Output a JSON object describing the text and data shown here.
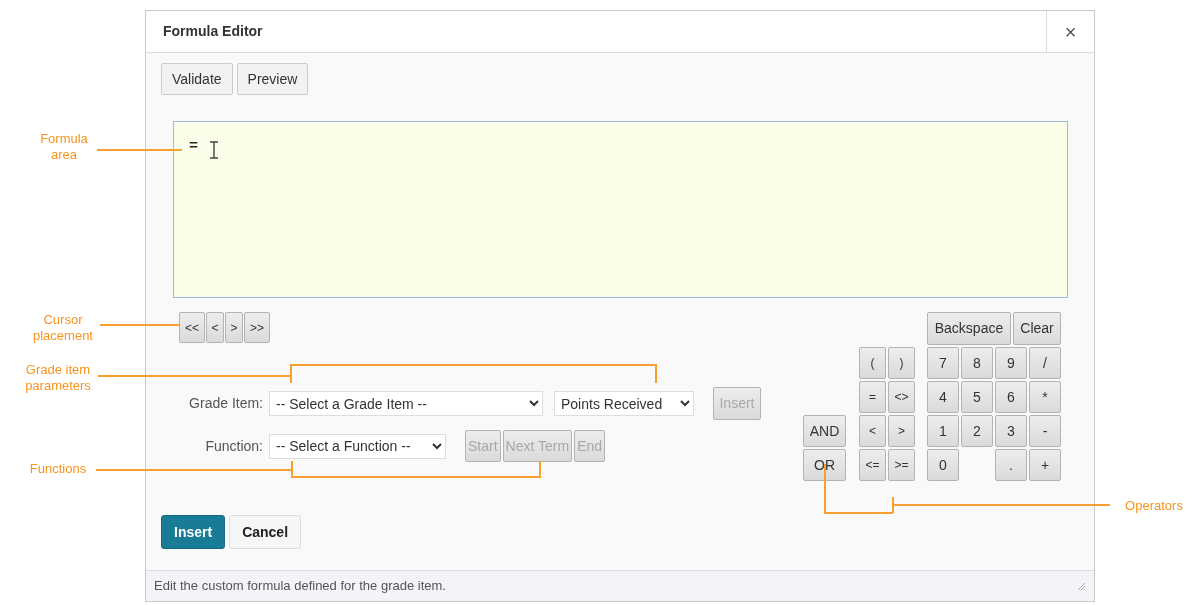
{
  "window": {
    "title": "Formula Editor",
    "close": "×"
  },
  "toolbar": [
    "Validate",
    "Preview"
  ],
  "formula": {
    "value": "="
  },
  "cursor_buttons": [
    "<<",
    "<",
    ">",
    ">>"
  ],
  "grade_item": {
    "label": "Grade Item:",
    "value": "-- Select a Grade Item --",
    "parameter": "Points Received",
    "insert": {
      "label": "Insert",
      "disabled": true
    }
  },
  "function": {
    "label": "Function:",
    "value": "-- Select a Function --",
    "buttons": [
      {
        "label": "Start",
        "disabled": true
      },
      {
        "label": "Next Term",
        "disabled": true
      },
      {
        "label": "End",
        "disabled": true
      }
    ]
  },
  "keypad": {
    "edit_keys": [
      "Backspace",
      "Clear"
    ],
    "logic_keys": [
      "AND",
      "OR"
    ],
    "operator_keys": [
      "(",
      ")",
      "=",
      "<>",
      "<",
      ">",
      "<=",
      ">="
    ],
    "number_rows": [
      [
        "7",
        "8",
        "9",
        "/"
      ],
      [
        "4",
        "5",
        "6",
        "*"
      ],
      [
        "1",
        "2",
        "3",
        "-"
      ],
      [
        "0",
        ".",
        "+"
      ]
    ]
  },
  "actions": [
    {
      "label": "Insert",
      "kind": "primary"
    },
    {
      "label": "Cancel",
      "kind": "secondary"
    }
  ],
  "status_bar": "Edit the custom formula defined for the grade item.",
  "annotations": [
    {
      "label": "Formula area"
    },
    {
      "label": "Cursor placement"
    },
    {
      "label": "Grade item parameters"
    },
    {
      "label": "Functions"
    },
    {
      "label": "Operators"
    }
  ]
}
